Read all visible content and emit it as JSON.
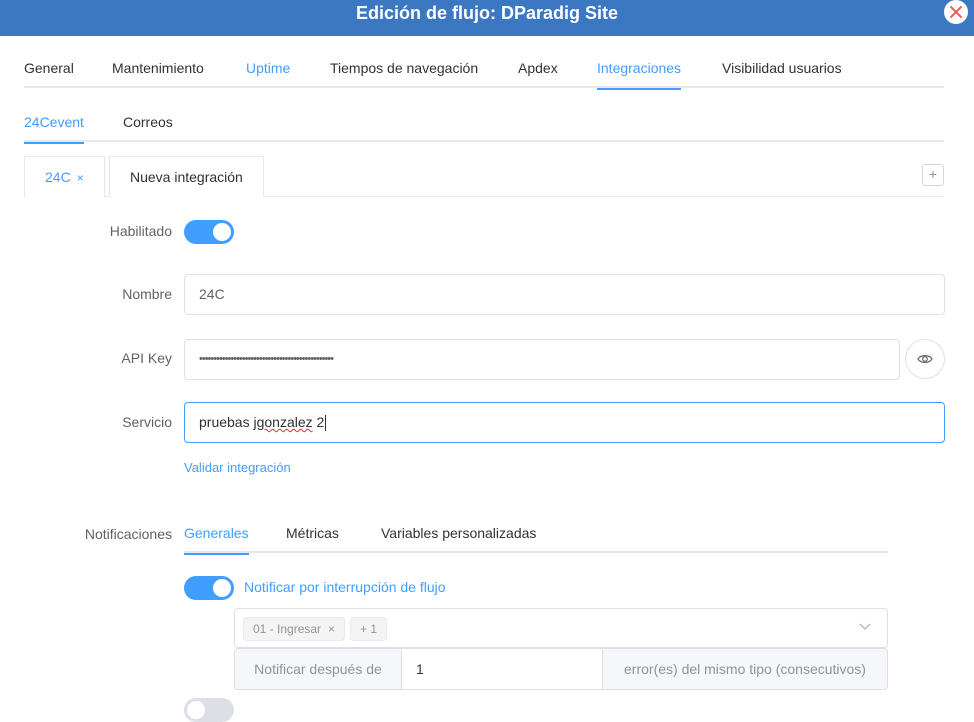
{
  "dialog": {
    "title": "Edición de flujo: DParadig Site"
  },
  "main_tabs": [
    {
      "label": "General"
    },
    {
      "label": "Mantenimiento"
    },
    {
      "label": "Uptime"
    },
    {
      "label": "Tiempos de navegación"
    },
    {
      "label": "Apdex"
    },
    {
      "label": "Integraciones"
    },
    {
      "label": "Visibilidad usuarios"
    }
  ],
  "integration_tabs": [
    {
      "label": "24Cevent"
    },
    {
      "label": "Correos"
    }
  ],
  "card_tabs": [
    {
      "label": "24C",
      "close": "×"
    },
    {
      "label": "Nueva integración"
    }
  ],
  "add_symbol": "+",
  "form": {
    "enabled_label": "Habilitado",
    "name_label": "Nombre",
    "name_value": "24C",
    "api_key_label": "API Key",
    "api_key_value": "•••••••••••••••••••••••••••••••••••••••••••••••",
    "service_label": "Servicio",
    "service_prefix": "pruebas ",
    "service_misspelled": "jgonzalez",
    "service_suffix": " 2",
    "validate_link": "Validar integración"
  },
  "notifications": {
    "label": "Notificaciones",
    "tabs": [
      {
        "label": "Generales"
      },
      {
        "label": "Métricas"
      },
      {
        "label": "Variables personalizadas"
      }
    ],
    "interrupt_label": "Notificar por interrupción de flujo",
    "chips": [
      {
        "label": "01 - Ingresar",
        "close": "×"
      },
      {
        "label": "+ 1"
      }
    ],
    "notify_after_label": "Notificar después de",
    "notify_after_value": "1",
    "notify_after_suffix": "error(es) del mismo tipo (consecutivos)"
  },
  "colors": {
    "header": "#3c78c2",
    "accent": "#409eff"
  }
}
